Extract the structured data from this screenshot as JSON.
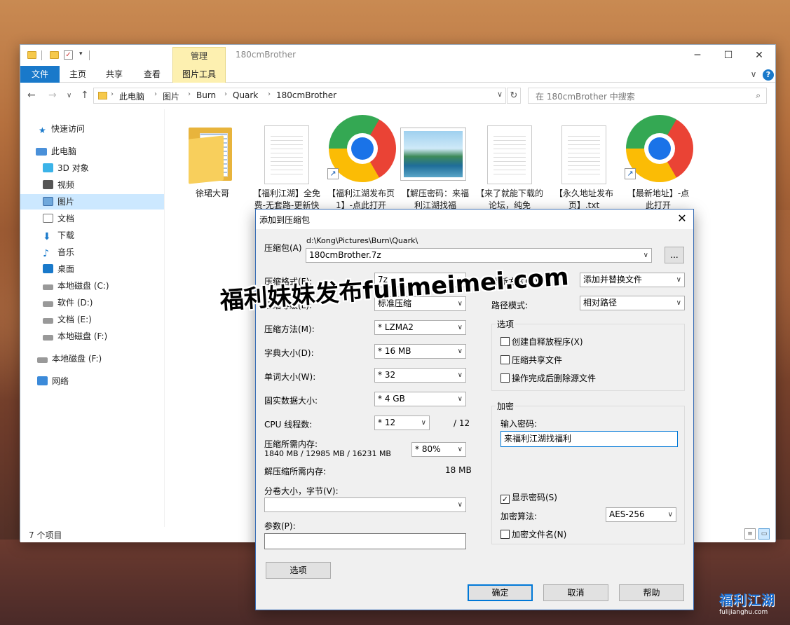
{
  "titlebar": {
    "manage_tab": "管理",
    "window_title": "180cmBrother",
    "minimize": "─",
    "maximize": "☐",
    "close": "✕"
  },
  "ribbon": {
    "tabs": [
      "文件",
      "主页",
      "共享",
      "查看",
      "图片工具"
    ],
    "expand": "∨",
    "help": "?"
  },
  "address": {
    "back": "←",
    "forward": "→",
    "recent": "∨",
    "up": "↑",
    "crumbs": [
      "此电脑",
      "图片",
      "Burn",
      "Quark",
      "180cmBrother"
    ],
    "refresh": "↻",
    "search_placeholder": "在 180cmBrother 中搜索"
  },
  "sidebar": {
    "items": [
      "快速访问",
      "此电脑",
      "3D 对象",
      "视频",
      "图片",
      "文档",
      "下载",
      "音乐",
      "桌面",
      "本地磁盘 (C:)",
      "软件 (D:)",
      "文档 (E:)",
      "本地磁盘 (F:)",
      "本地磁盘 (F:)",
      "网络"
    ],
    "selected": "图片"
  },
  "files": [
    {
      "label": "徐珺大哥",
      "type": "folder"
    },
    {
      "label": "【福利江湖】全免费-无套路-更新快",
      "type": "text"
    },
    {
      "label": "【福利江湖发布页1】-点此打开",
      "type": "chrome-shortcut"
    },
    {
      "label": "【解压密码：来福利江湖找福利】.jpg",
      "type": "image"
    },
    {
      "label": "【来了就能下载的论坛，纯免费】.txt",
      "type": "text"
    },
    {
      "label": "【永久地址发布页】.txt",
      "type": "text"
    },
    {
      "label": "【最新地址】-点此打开",
      "type": "chrome-shortcut"
    }
  ],
  "status": {
    "count": "7 个项目"
  },
  "dialog": {
    "title": "添加到压缩包",
    "archive_label": "压缩包(A)",
    "archive_path": "d:\\Kong\\Pictures\\Burn\\Quark\\",
    "archive_name": "180cmBrother.7z",
    "browse": "...",
    "format_label": "压缩格式(F):",
    "format_value": "7z",
    "level_label": "压缩等级(L):",
    "level_value": "标准压缩",
    "method_label": "压缩方法(M):",
    "method_value": "* LZMA2",
    "dict_label": "字典大小(D):",
    "dict_value": "* 16 MB",
    "word_label": "单词大小(W):",
    "word_value": "* 32",
    "solid_label": "固实数据大小:",
    "solid_value": "* 4 GB",
    "cpu_label": "CPU 线程数:",
    "cpu_value": "* 12",
    "cpu_total": "/ 12",
    "mem_label": "压缩所需内存:",
    "mem_values": "1840 MB / 12985 MB / 16231 MB",
    "mem_percent": "* 80%",
    "decomp_label": "解压缩所需内存:",
    "decomp_value": "18 MB",
    "split_label": "分卷大小，字节(V):",
    "params_label": "参数(P):",
    "options_btn": "选项",
    "update_label": "更新方式(U):",
    "update_value": "添加并替换文件",
    "pathmode_label": "路径模式:",
    "pathmode_value": "相对路径",
    "options_group": "选项",
    "opt_sfx": "创建自释放程序(X)",
    "opt_shared": "压缩共享文件",
    "opt_delete": "操作完成后删除源文件",
    "encrypt_group": "加密",
    "password_label": "输入密码:",
    "password_value": "来福利江湖找福利",
    "show_password": "显示密码(S)",
    "enc_method_label": "加密算法:",
    "enc_method_value": "AES-256",
    "enc_names": "加密文件名(N)",
    "ok": "确定",
    "cancel": "取消",
    "help": "帮助",
    "close": "✕"
  },
  "overlay": {
    "watermark": "福利妹妹发布fulimeimei.com",
    "logo_main": "福利江湖",
    "logo_sub": "fulijianghu.com"
  }
}
